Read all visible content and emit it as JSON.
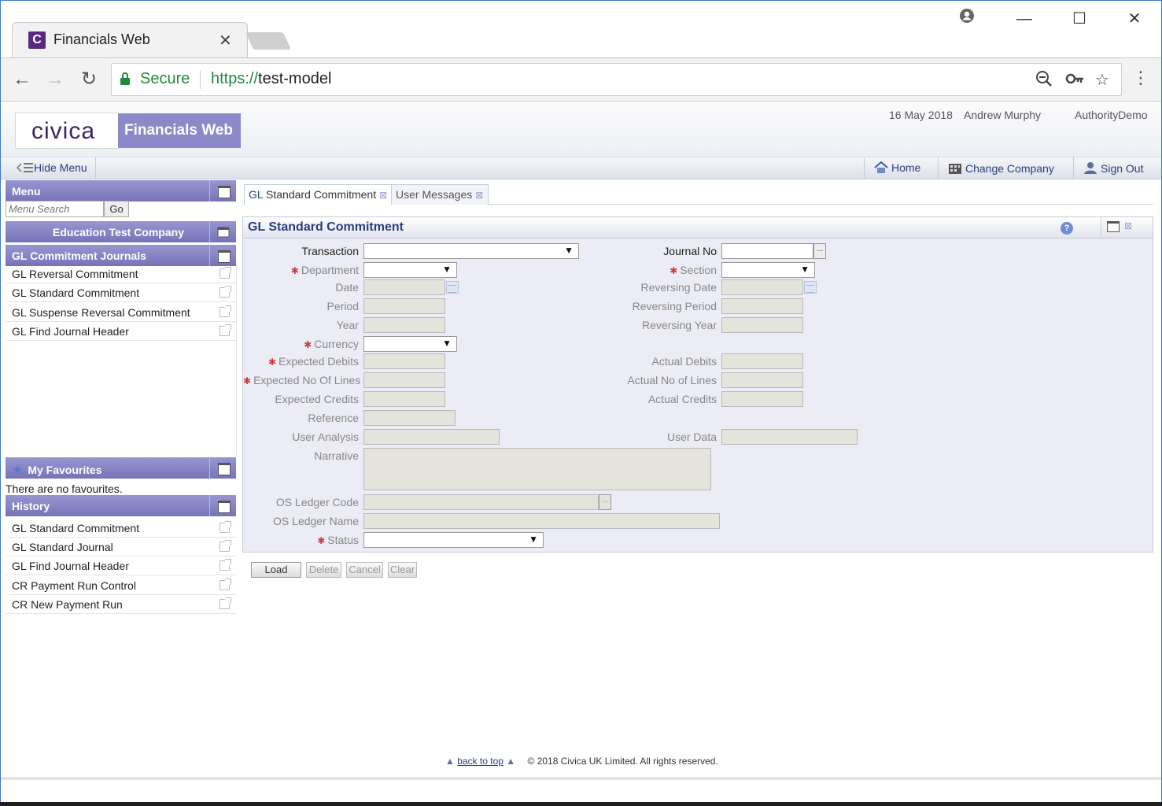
{
  "browser": {
    "tab_title": "Financials Web",
    "favicon_letter": "C",
    "tab_close": "✕",
    "secure_label": "Secure",
    "url_scheme": "https://",
    "url_host": "test-model"
  },
  "header": {
    "logo": "CIVICA",
    "product": "Financials Web",
    "date": "16 May 2018",
    "user": "Andrew Murphy",
    "authority": "AuthorityDemo"
  },
  "menubar": {
    "hide_menu": "Hide Menu",
    "home": "Home",
    "change_company": "Change Company",
    "sign_out": "Sign Out"
  },
  "sidebar": {
    "menu_title": "Menu",
    "search_placeholder": "Menu Search",
    "go_label": "Go",
    "company": "Education Test Company",
    "section_title": "GL Commitment Journals",
    "items": [
      {
        "label": "GL Reversal Commitment"
      },
      {
        "label": "GL Standard Commitment"
      },
      {
        "label": "GL Suspense Reversal Commitment"
      },
      {
        "label": "GL Find Journal Header"
      }
    ],
    "favourites_title": "My Favourites",
    "no_favourites": "There are no favourites.",
    "history_title": "History",
    "history": [
      {
        "label": "GL Standard Commitment"
      },
      {
        "label": "GL Standard Journal"
      },
      {
        "label": "GL Find Journal Header"
      },
      {
        "label": "CR Payment Run Control"
      },
      {
        "label": "CR New Payment Run"
      }
    ]
  },
  "tabs": [
    {
      "prefix": "GL",
      "label": "Standard Commitment"
    },
    {
      "label": "User Messages"
    }
  ],
  "form": {
    "title": "GL Standard Commitment",
    "help": "?",
    "required_mark": "✱",
    "labels": {
      "transaction": "Transaction",
      "journal_no": "Journal No",
      "department": "Department",
      "section": "Section",
      "date": "Date",
      "reversing_date": "Reversing Date",
      "period": "Period",
      "reversing_period": "Reversing Period",
      "year": "Year",
      "reversing_year": "Reversing Year",
      "currency": "Currency",
      "expected_debits": "Expected Debits",
      "actual_debits": "Actual Debits",
      "expected_no_lines": "Expected No Of Lines",
      "actual_no_lines": "Actual No of Lines",
      "expected_credits": "Expected Credits",
      "actual_credits": "Actual Credits",
      "reference": "Reference",
      "user_analysis": "User Analysis",
      "user_data": "User Data",
      "narrative": "Narrative",
      "os_ledger_code": "OS Ledger Code",
      "os_ledger_name": "OS Ledger Name",
      "status": "Status"
    },
    "ellipsis": "...",
    "select_arrow": "▼"
  },
  "actions": {
    "load": "Load",
    "delete": "Delete",
    "cancel": "Cancel",
    "clear": "Clear"
  },
  "footer": {
    "back_to_top": "back to top",
    "copyright": "© 2018 Civica UK Limited. All rights reserved."
  },
  "colors": {
    "accent": "#7674b8",
    "brand": "#3b2462",
    "link": "#2a3e7d",
    "required": "#d23a3a"
  }
}
